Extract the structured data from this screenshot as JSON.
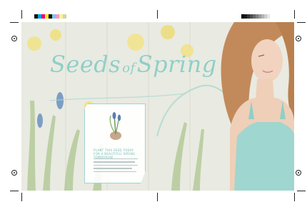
{
  "artwork": {
    "title_main": "Seeds",
    "title_of": "of",
    "title_end": "Spring",
    "card_heading": "PLANT THIS SEED TODAY FOR A BEAUTIFUL SPRING TOMORROW"
  },
  "colors": {
    "title": "#8fcfc6",
    "accent": "#6fbab0",
    "card_border": "#9fd6cf"
  },
  "color_bar": [
    "#111111",
    "#00a0e0",
    "#e6007e",
    "#ffe600",
    "#0d0d0d",
    "#7fc6e9",
    "#f49ac1",
    "#fff28f",
    "#cfd6a7"
  ],
  "gray_bar": [
    "#000000",
    "#1a1a1a",
    "#333333",
    "#4d4d4d",
    "#666666",
    "#808080",
    "#999999",
    "#b3b3b3",
    "#cccccc",
    "#e6e6e6"
  ]
}
